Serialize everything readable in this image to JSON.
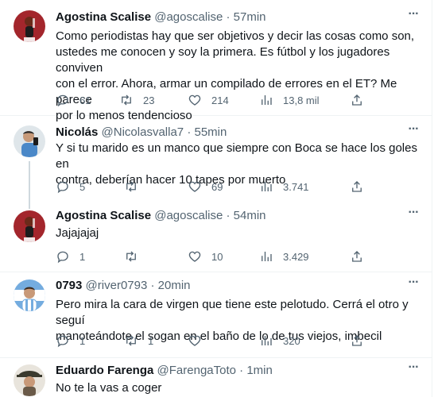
{
  "replies": [
    {
      "name": "Agostina Scalise",
      "handle": "@agoscalise",
      "time": "57min",
      "text": "Como periodistas hay que ser objetivos y decir las cosas como son,\nustedes me conocen y soy la primera. Es fútbol y los jugadores conviven\ncon el error. Ahora, armar un compilado de errores en el ET? Me parece\npor lo menos tendencioso",
      "replies": "61",
      "retweets": "23",
      "likes": "214",
      "views": "13,8 mil"
    },
    {
      "name": "Nicolás",
      "handle": "@Nicolasvalla7",
      "time": "55min",
      "text": "Y si tu marido es un manco que siempre con Boca se hace los goles en\ncontra, deberían hacer 10 tapes por muerto",
      "replies": "5",
      "retweets": "",
      "likes": "69",
      "views": "3.741"
    },
    {
      "name": "Agostina Scalise",
      "handle": "@agoscalise",
      "time": "54min",
      "text": "Jajajajaj",
      "replies": "1",
      "retweets": "",
      "likes": "10",
      "views": "3.429"
    },
    {
      "name": "0793",
      "handle": "@river0793",
      "time": "20min",
      "text": "Pero mira la cara de virgen que tiene este pelotudo. Cerrá el otro y seguí\nmanoteándote el sogan en el baño de lo de tus viejos, imbecil",
      "replies": "1",
      "retweets": "1",
      "likes": "",
      "views": "320"
    },
    {
      "name": "Eduardo Farenga",
      "handle": "@FarengaToto",
      "time": "1min",
      "text": "No te la vas a coger"
    }
  ],
  "separator": "·",
  "more_icon": "more-dots-icon",
  "icons": [
    "reply-icon",
    "retweet-icon",
    "like-icon",
    "views-icon",
    "share-icon"
  ],
  "colors": {
    "text": "#0f1419",
    "secondary": "#536471",
    "divider": "#eff3f4",
    "thread_line": "#cfd9de"
  }
}
